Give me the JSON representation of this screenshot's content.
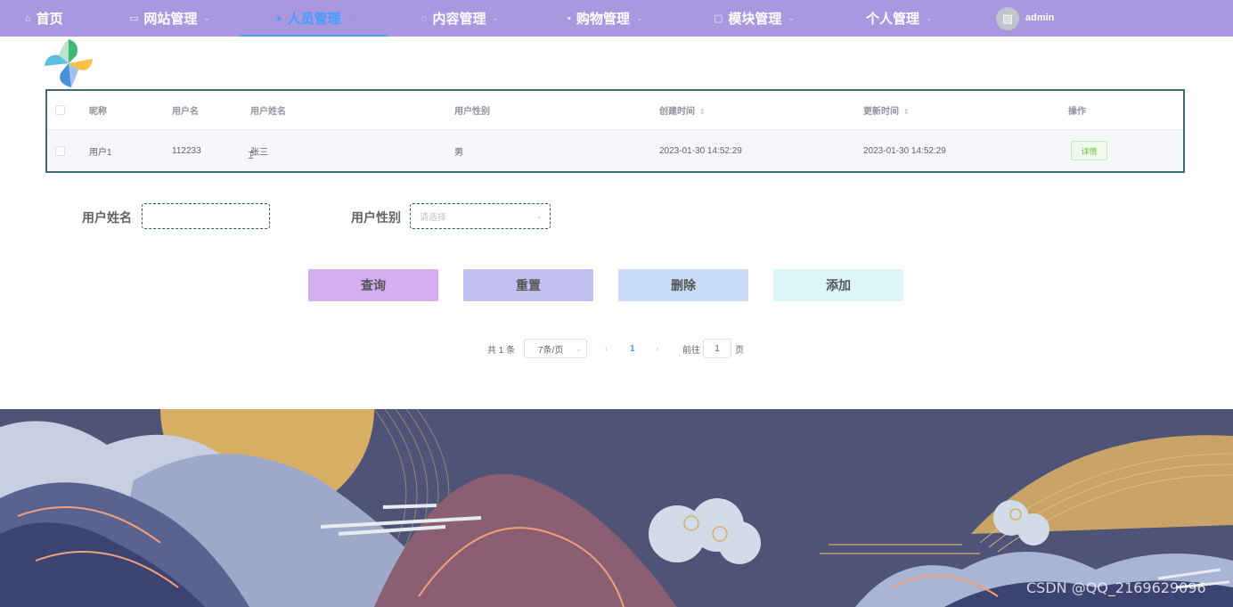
{
  "nav": {
    "items": [
      {
        "label": "首页",
        "icon": "home-icon",
        "glyph": "⌂"
      },
      {
        "label": "网站管理",
        "icon": "monitor-icon",
        "glyph": "▭"
      },
      {
        "label": "人员管理",
        "icon": "user-icon",
        "glyph": "●"
      },
      {
        "label": "内容管理",
        "icon": "chat-icon",
        "glyph": "◌"
      },
      {
        "label": "购物管理",
        "icon": "bag-icon",
        "glyph": "▪"
      },
      {
        "label": "模块管理",
        "icon": "copy-icon",
        "glyph": "▢"
      },
      {
        "label": "个人管理",
        "icon": "",
        "glyph": ""
      }
    ],
    "active": "人员管理",
    "active_color": "#409eff",
    "background": "#a997df",
    "user": "admin"
  },
  "table": {
    "headers": {
      "nickname": "昵称",
      "username": "用户名",
      "realname": "用户姓名",
      "gender": "用户性别",
      "created": "创建时间",
      "updated": "更新时间",
      "actions": "操作"
    },
    "rows": [
      {
        "nickname": "用户1",
        "username": "112233",
        "realname": "张三",
        "gender": "男",
        "created": "2023-01-30 14:52:29",
        "updated": "2023-01-30 14:52:29",
        "action": "详情"
      }
    ]
  },
  "search": {
    "name_label": "用户姓名",
    "name_value": "",
    "gender_label": "用户性别",
    "gender_placeholder": "请选择"
  },
  "buttons": {
    "query": "查询",
    "reset": "重置",
    "delete": "删除",
    "add": "添加"
  },
  "pagination": {
    "total": "共 1 条",
    "page_size": "7条/页",
    "current": "1",
    "goto_prefix": "前往",
    "goto_value": "1",
    "goto_suffix": "页"
  },
  "watermark": "CSDN @QQ_2169629096"
}
